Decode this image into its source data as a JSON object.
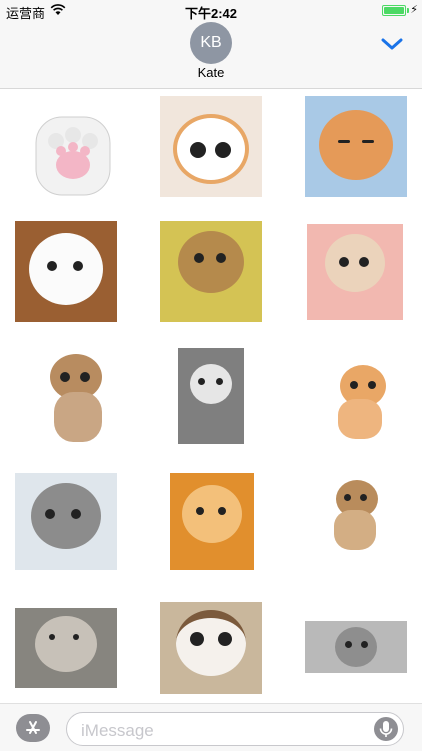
{
  "status_bar": {
    "carrier": "运营商",
    "time": "下午2:42",
    "battery_level": 1.0
  },
  "header": {
    "avatar_initials": "KB",
    "contact_name": "Kate"
  },
  "stickers": [
    {
      "name": "paw-sticker"
    },
    {
      "name": "kitten-sticker-1"
    },
    {
      "name": "kitten-sticker-2"
    },
    {
      "name": "kitten-sticker-3"
    },
    {
      "name": "kitten-sticker-4"
    },
    {
      "name": "kitten-sticker-5"
    },
    {
      "name": "kitten-sticker-6"
    },
    {
      "name": "kitten-sticker-7"
    },
    {
      "name": "kitten-sticker-8"
    },
    {
      "name": "kitten-sticker-9"
    },
    {
      "name": "kitten-sticker-10"
    },
    {
      "name": "kitten-sticker-11"
    },
    {
      "name": "kitten-sticker-12"
    },
    {
      "name": "kitten-sticker-13"
    },
    {
      "name": "kitten-sticker-14"
    }
  ],
  "input": {
    "placeholder": "iMessage"
  },
  "colors": {
    "accent": "#1a73e8",
    "battery": "#4cd964",
    "avatar": "#8e96a3"
  }
}
